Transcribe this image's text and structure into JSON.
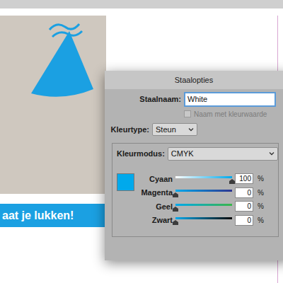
{
  "document": {
    "banner": "aat je lukken!"
  },
  "dialog": {
    "title": "Staalopties",
    "name_field": {
      "label": "Staalnaam:",
      "value": "White",
      "focused": true
    },
    "checkbox": {
      "label": "Naam met kleurwaarde",
      "checked": false,
      "disabled": true
    },
    "color_type": {
      "label": "Kleurtype:",
      "value": "Steun"
    },
    "color_mode": {
      "label": "Kleurmodus:",
      "value": "CMYK"
    },
    "swatch": {
      "color": "#00a9ec"
    },
    "sliders": [
      {
        "name": "Cyaan",
        "value": "100",
        "unit": "%",
        "level": 1,
        "color": "#00a9ec"
      },
      {
        "name": "Magenta",
        "value": "0",
        "unit": "%",
        "level": 0,
        "color": "#2d3590"
      },
      {
        "name": "Geel",
        "value": "0",
        "unit": "%",
        "level": 0,
        "color": "#3ab54a"
      },
      {
        "name": "Zwart",
        "value": "0",
        "unit": "%",
        "level": 0,
        "color": "#0a0a0a"
      }
    ]
  }
}
